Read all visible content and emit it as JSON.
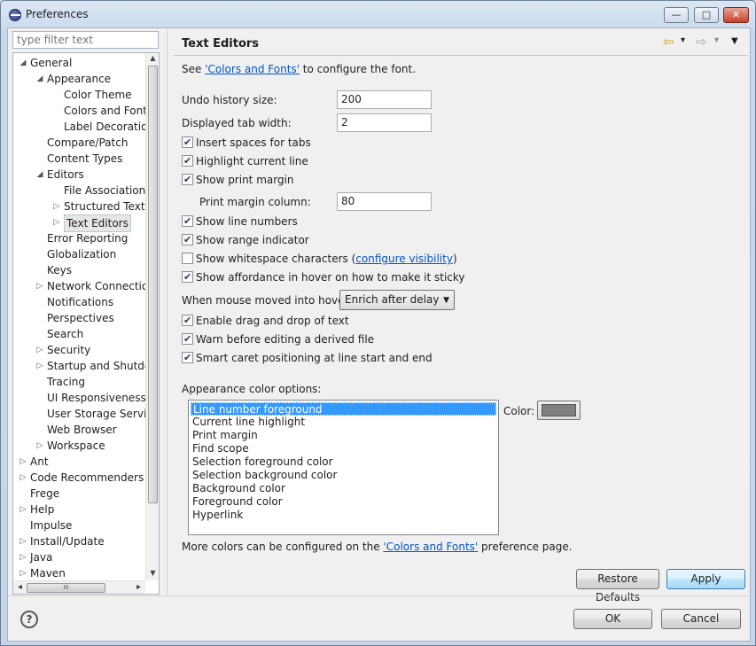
{
  "window": {
    "title": "Preferences",
    "minimize": "—",
    "maximize": "□",
    "close": "✕"
  },
  "filter": {
    "placeholder": "type filter text"
  },
  "tree": [
    {
      "label": "General",
      "level": 0,
      "arrow": "◢"
    },
    {
      "label": "Appearance",
      "level": 1,
      "arrow": "◢"
    },
    {
      "label": "Color Theme",
      "level": 2,
      "arrow": ""
    },
    {
      "label": "Colors and Fonts",
      "level": 2,
      "arrow": ""
    },
    {
      "label": "Label Decorations",
      "level": 2,
      "arrow": ""
    },
    {
      "label": "Compare/Patch",
      "level": 1,
      "arrow": ""
    },
    {
      "label": "Content Types",
      "level": 1,
      "arrow": ""
    },
    {
      "label": "Editors",
      "level": 1,
      "arrow": "◢"
    },
    {
      "label": "File Associations",
      "level": 2,
      "arrow": ""
    },
    {
      "label": "Structured Text Editors",
      "level": 2,
      "arrow": "▷"
    },
    {
      "label": "Text Editors",
      "level": 2,
      "arrow": "▷",
      "selected": true
    },
    {
      "label": "Error Reporting",
      "level": 1,
      "arrow": ""
    },
    {
      "label": "Globalization",
      "level": 1,
      "arrow": ""
    },
    {
      "label": "Keys",
      "level": 1,
      "arrow": ""
    },
    {
      "label": "Network Connections",
      "level": 1,
      "arrow": "▷"
    },
    {
      "label": "Notifications",
      "level": 1,
      "arrow": ""
    },
    {
      "label": "Perspectives",
      "level": 1,
      "arrow": ""
    },
    {
      "label": "Search",
      "level": 1,
      "arrow": ""
    },
    {
      "label": "Security",
      "level": 1,
      "arrow": "▷"
    },
    {
      "label": "Startup and Shutdown",
      "level": 1,
      "arrow": "▷"
    },
    {
      "label": "Tracing",
      "level": 1,
      "arrow": ""
    },
    {
      "label": "UI Responsiveness Monitoring",
      "level": 1,
      "arrow": ""
    },
    {
      "label": "User Storage Service",
      "level": 1,
      "arrow": ""
    },
    {
      "label": "Web Browser",
      "level": 1,
      "arrow": ""
    },
    {
      "label": "Workspace",
      "level": 1,
      "arrow": "▷"
    },
    {
      "label": "Ant",
      "level": 0,
      "arrow": "▷"
    },
    {
      "label": "Code Recommenders",
      "level": 0,
      "arrow": "▷"
    },
    {
      "label": "Frege",
      "level": 0,
      "arrow": ""
    },
    {
      "label": "Help",
      "level": 0,
      "arrow": "▷"
    },
    {
      "label": "Impulse",
      "level": 0,
      "arrow": ""
    },
    {
      "label": "Install/Update",
      "level": 0,
      "arrow": "▷"
    },
    {
      "label": "Java",
      "level": 0,
      "arrow": "▷"
    },
    {
      "label": "Maven",
      "level": 0,
      "arrow": "▷"
    }
  ],
  "scroll": {
    "up": "▲",
    "down": "▼",
    "left": "◂",
    "right": "▸",
    "grip": "III"
  },
  "page": {
    "title": "Text Editors",
    "nav": {
      "back": "⇦",
      "forward": "⇨",
      "dropdown": "▾",
      "menu": "▼"
    },
    "see_prefix": "See ",
    "see_link": "'Colors and Fonts'",
    "see_suffix": " to configure the font.",
    "undo_label": "Undo history size:",
    "undo_value": "200",
    "tab_label": "Displayed tab width:",
    "tab_value": "2",
    "insert_spaces": "Insert spaces for tabs",
    "highlight_line": "Highlight current line",
    "show_print_margin": "Show print margin",
    "print_margin_label": "Print margin column:",
    "print_margin_value": "80",
    "show_line_numbers": "Show line numbers",
    "show_range": "Show range indicator",
    "show_whitespace": "Show whitespace characters",
    "whitespace_open": "(",
    "configure_visibility": "configure visibility",
    "whitespace_close": ")",
    "show_affordance": "Show affordance in hover on how to make it sticky",
    "hover_label": "When mouse moved into hover:",
    "hover_value": "Enrich after delay",
    "drag_drop": "Enable drag and drop of text",
    "warn_derived": "Warn before editing a derived file",
    "smart_caret": "Smart caret positioning at line start and end",
    "appearance_label": "Appearance color options:",
    "color_items": [
      "Line number foreground",
      "Current line highlight",
      "Print margin",
      "Find scope",
      "Selection foreground color",
      "Selection background color",
      "Background color",
      "Foreground color",
      "Hyperlink"
    ],
    "color_label": "Color:",
    "swatch_color": "#808080",
    "more_prefix": "More colors can be configured on the ",
    "more_link": "'Colors and Fonts'",
    "more_suffix": " preference page.",
    "restore_defaults": "Restore Defaults",
    "apply": "Apply"
  },
  "checkboxes": {
    "insert_spaces": true,
    "highlight_line": true,
    "show_print_margin": true,
    "show_line_numbers": true,
    "show_range": true,
    "show_whitespace": false,
    "show_affordance": true,
    "drag_drop": true,
    "warn_derived": true,
    "smart_caret": true
  },
  "footer": {
    "help": "?",
    "ok": "OK",
    "cancel": "Cancel"
  }
}
